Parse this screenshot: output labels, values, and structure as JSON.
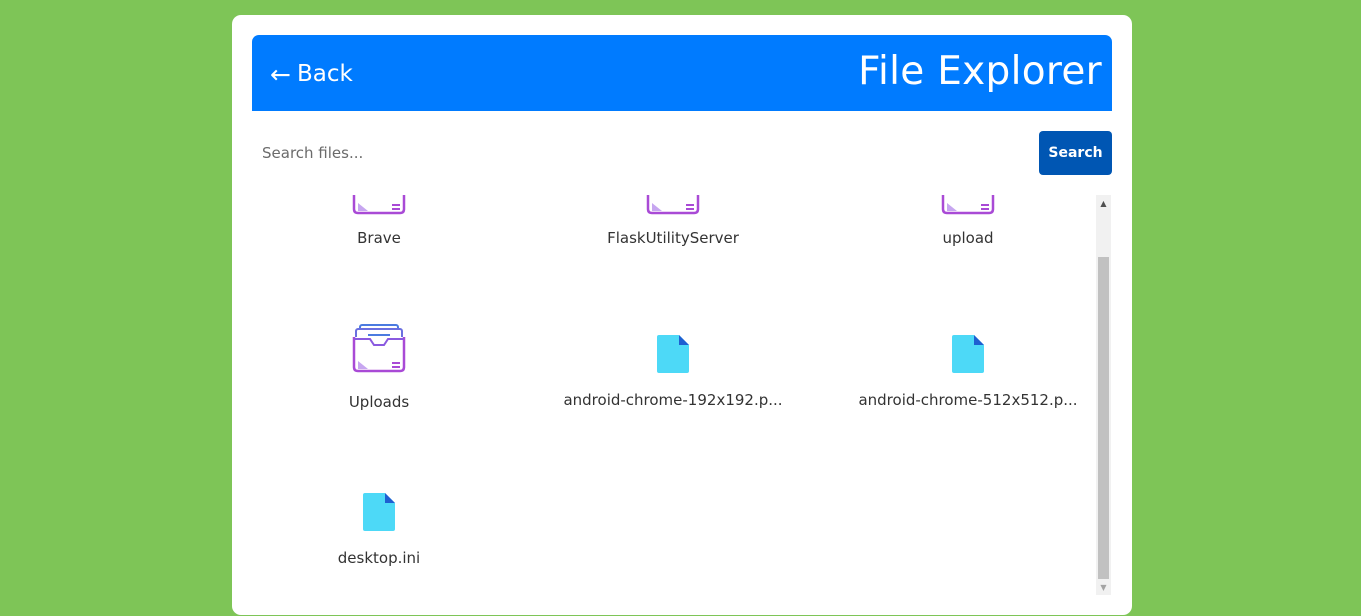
{
  "header": {
    "back_arrow": "←",
    "back_label": "Back",
    "title": "File Explorer"
  },
  "search": {
    "placeholder": "Search files...",
    "button_label": "Search"
  },
  "items": [
    {
      "name": "Brave",
      "type": "folder"
    },
    {
      "name": "FlaskUtilityServer",
      "type": "folder"
    },
    {
      "name": "upload",
      "type": "folder"
    },
    {
      "name": "Uploads",
      "type": "folder"
    },
    {
      "name": "android-chrome-192x192.p...",
      "type": "file"
    },
    {
      "name": "android-chrome-512x512.p...",
      "type": "file"
    },
    {
      "name": "desktop.ini",
      "type": "file"
    }
  ],
  "colors": {
    "background": "#7ec557",
    "header": "#007bff",
    "search_button": "#0056b3",
    "folder_stroke": "#a94ad6",
    "file_icon": "#4dd9f7"
  },
  "icons": {
    "folder": "folder-icon",
    "file": "file-icon"
  }
}
